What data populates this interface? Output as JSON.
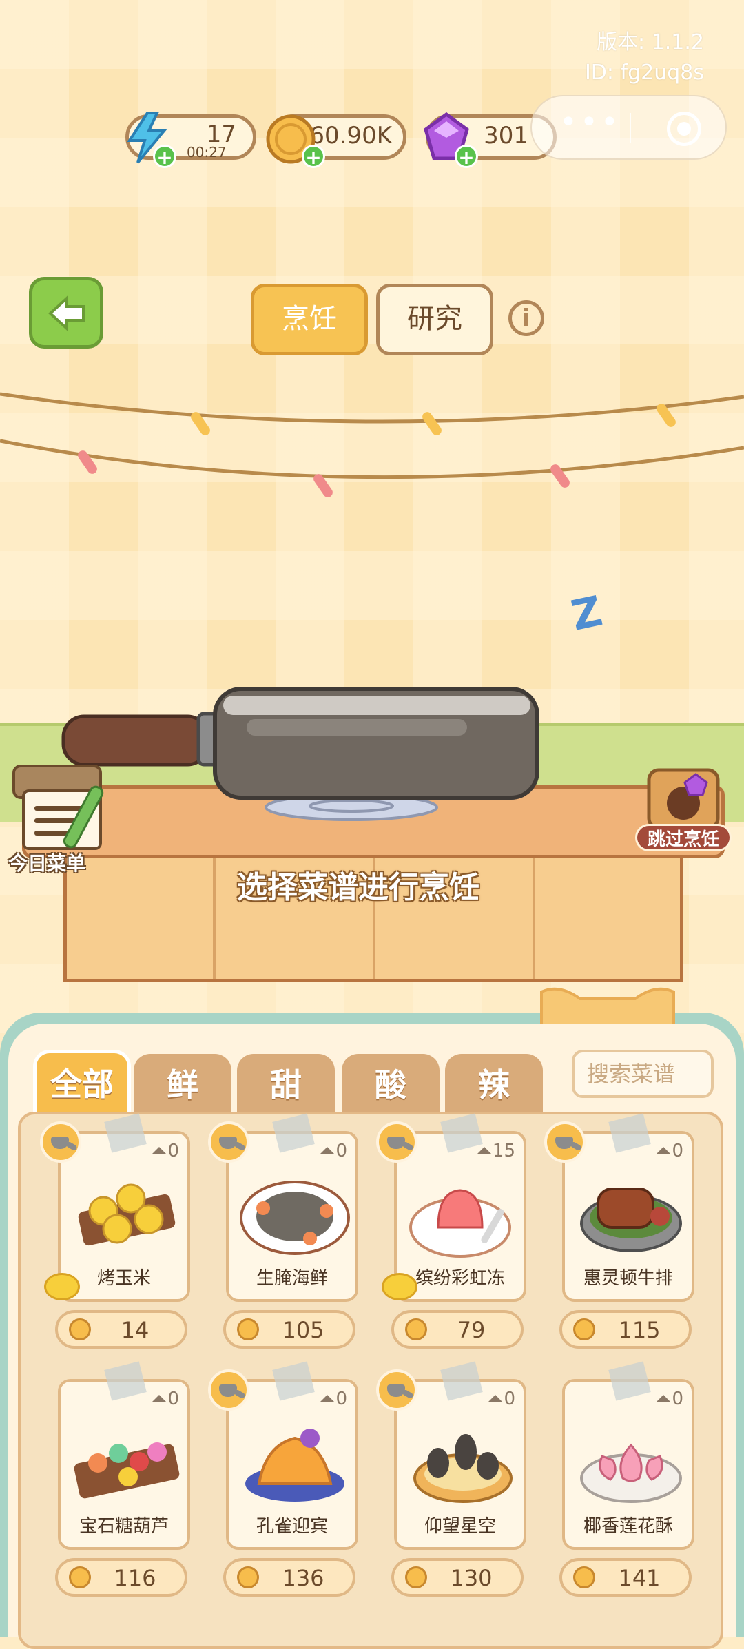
{
  "app": {
    "version_label": "版本: 1.1.2",
    "id_label": "ID: fg2uq8s"
  },
  "resources": {
    "energy": {
      "value": "17",
      "timer": "00:27",
      "icon": "lightning-icon"
    },
    "coins": {
      "value": "60.90K",
      "icon": "coin-icon"
    },
    "gems": {
      "value": "301",
      "icon": "gem-icon"
    }
  },
  "mode_tabs": {
    "cook": "烹饪",
    "research": "研究",
    "info": "i"
  },
  "kitchen": {
    "prompt": "选择菜谱进行烹饪",
    "today_menu": "今日菜单",
    "skip_cooking": "跳过烹饪",
    "sleep_glyph": "Z"
  },
  "categories": [
    "全部",
    "鲜",
    "甜",
    "酸",
    "辣"
  ],
  "search": {
    "placeholder": "搜索菜谱"
  },
  "recipes": [
    {
      "name": "烤玉米",
      "owned": "0",
      "price": "14",
      "cookable": true,
      "sour": true
    },
    {
      "name": "生腌海鲜",
      "owned": "0",
      "price": "105",
      "cookable": true,
      "sour": false
    },
    {
      "name": "缤纷彩虹冻",
      "owned": "15",
      "price": "79",
      "cookable": true,
      "sour": true
    },
    {
      "name": "惠灵顿牛排",
      "owned": "0",
      "price": "115",
      "cookable": true,
      "sour": false
    },
    {
      "name": "宝石糖葫芦",
      "owned": "0",
      "price": "116",
      "cookable": false,
      "sour": false
    },
    {
      "name": "孔雀迎宾",
      "owned": "0",
      "price": "136",
      "cookable": true,
      "sour": false
    },
    {
      "name": "仰望星空",
      "owned": "0",
      "price": "130",
      "cookable": true,
      "sour": false
    },
    {
      "name": "椰香莲花酥",
      "owned": "0",
      "price": "141",
      "cookable": false,
      "sour": false
    }
  ],
  "colors": {
    "background": "#fce5b4",
    "accent": "#f7bd4c",
    "border": "#b18658",
    "panel_frame": "#a8d4c6",
    "energy_icon": "#4fc0e8",
    "gem_icon": "#b25be0",
    "plus": "#59c24b"
  }
}
